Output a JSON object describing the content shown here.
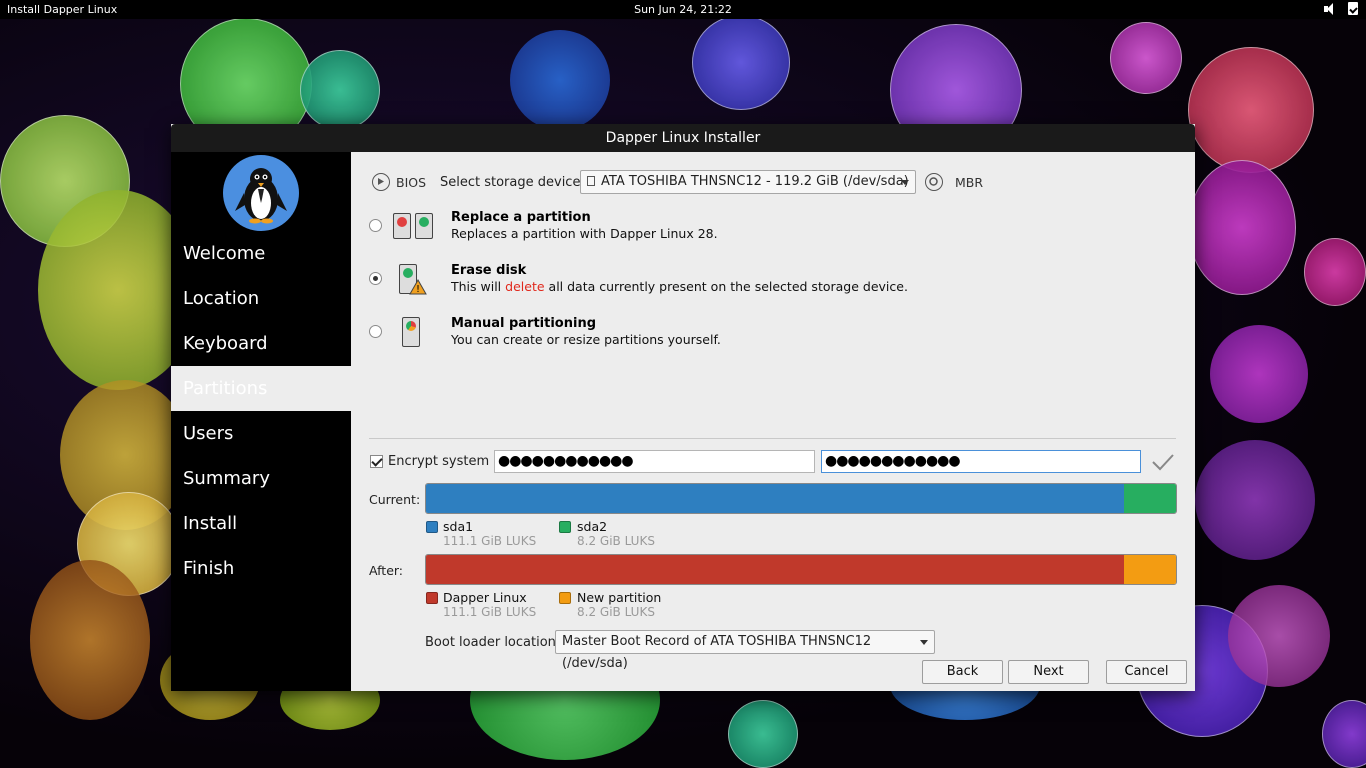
{
  "topbar": {
    "app_name": "Install Dapper Linux",
    "clock": "Sun Jun 24, 21:22",
    "tray_icons": [
      "volume-icon",
      "clipboard-check-icon"
    ]
  },
  "window": {
    "title": "Dapper Linux Installer"
  },
  "sidebar": {
    "steps": [
      {
        "label": "Welcome",
        "active": false
      },
      {
        "label": "Location",
        "active": false
      },
      {
        "label": "Keyboard",
        "active": false
      },
      {
        "label": "Partitions",
        "active": true
      },
      {
        "label": "Users",
        "active": false
      },
      {
        "label": "Summary",
        "active": false
      },
      {
        "label": "Install",
        "active": false
      },
      {
        "label": "Finish",
        "active": false
      }
    ]
  },
  "partitions": {
    "firmware_label": "BIOS",
    "device_label": "Select storage device:",
    "device_value": "ATA TOSHIBA THNSNC12 - 119.2 GiB (/dev/sda)",
    "table_type": "MBR",
    "options": [
      {
        "title": "Replace a partition",
        "description": "Replaces a partition with Dapper Linux 28.",
        "selected": false
      },
      {
        "title": "Erase disk",
        "description_before": "This will",
        "description_highlight": "delete",
        "description_after": "all data currently present on the selected storage device.",
        "selected": true
      },
      {
        "title": "Manual partitioning",
        "description": "You can create or resize partitions yourself.",
        "selected": false
      }
    ],
    "encrypt_label": "Encrypt system",
    "encrypt_checked": true,
    "passphrase": "●●●●●●●●●●●●",
    "passphrase_confirm": "●●●●●●●●●●●●",
    "current_label": "Current:",
    "after_label": "After:",
    "current": [
      {
        "name": "sda1",
        "info": "111.1 GiB  LUKS",
        "color": "#2e7fc0",
        "size_gib": 111.1
      },
      {
        "name": "sda2",
        "info": "8.2 GiB  LUKS",
        "color": "#27ae60",
        "size_gib": 8.2
      }
    ],
    "after": [
      {
        "name": "Dapper Linux",
        "info": "111.1 GiB  LUKS",
        "color": "#c0392b",
        "size_gib": 111.1
      },
      {
        "name": "New partition",
        "info": "8.2 GiB  LUKS",
        "color": "#f39c12",
        "size_gib": 8.2
      }
    ],
    "bootloader_label": "Boot loader location:",
    "bootloader_value": "Master Boot Record of ATA TOSHIBA THNSNC12 (/dev/sda)"
  },
  "buttons": {
    "back": "Back",
    "next": "Next",
    "cancel": "Cancel"
  }
}
